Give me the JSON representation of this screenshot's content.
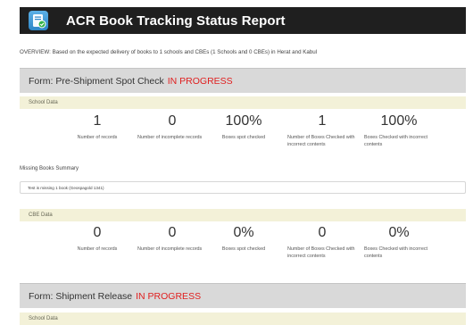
{
  "header": {
    "title": "ACR Book Tracking Status Report",
    "icon": "book-check-icon",
    "bg_color": "#1f1f1f"
  },
  "overview": "OVERVIEW: Based on the expected delivery of books to 1 schools and CBEs (1 Schools and 0 CBEs) in Herat and Kabul",
  "forms": [
    {
      "title": "Form: Pre-Shipment Spot Check",
      "status": "IN PROGRESS",
      "school_section": "School Data",
      "school_stats": [
        {
          "value": "1",
          "label": "Number of records"
        },
        {
          "value": "0",
          "label": "Number of incomplete records"
        },
        {
          "value": "100%",
          "label": "Boxes spot checked"
        },
        {
          "value": "1",
          "label": "Number of Boxes Checked with incorrect contents"
        },
        {
          "value": "100%",
          "label": "Boxes Checked with incorrect contents"
        }
      ],
      "missing_heading": "Missing Books Summary",
      "missing_items": [
        "Test is missing 1 book (Geospagold 1341)"
      ],
      "cbe_section": "CBE Data",
      "cbe_stats": [
        {
          "value": "0",
          "label": "Number of records"
        },
        {
          "value": "0",
          "label": "Number of incomplete records"
        },
        {
          "value": "0%",
          "label": "Boxes spot checked"
        },
        {
          "value": "0",
          "label": "Number of Boxes Checked with incorrect contents"
        },
        {
          "value": "0%",
          "label": "Boxes Checked with incorrect contents"
        }
      ]
    },
    {
      "title": "Form: Shipment Release",
      "status": "IN PROGRESS",
      "school_section": "School Data"
    }
  ],
  "colors": {
    "status": "#e02020",
    "form_header_bg": "#d9d9d9",
    "section_bg": "#f3f1d8"
  }
}
